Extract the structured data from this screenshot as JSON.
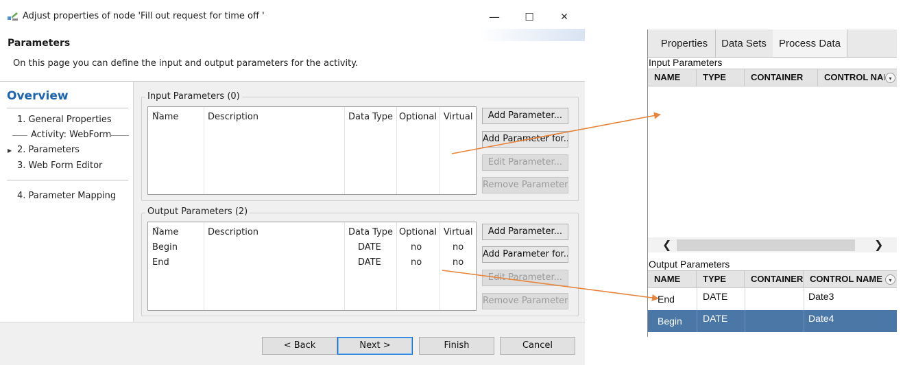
{
  "window": {
    "title": "Adjust properties of node 'Fill out request for time off '",
    "minimize_glyph": "—",
    "maximize_glyph": "☐",
    "close_glyph": "✕"
  },
  "header": {
    "title": "Parameters",
    "description": "On this page you can define the input and output parameters for the activity."
  },
  "nav": {
    "title": "Overview",
    "items": [
      {
        "label": "1. General Properties"
      },
      {
        "label": "2. Parameters"
      },
      {
        "label": "3. Web Form Editor"
      },
      {
        "label": "4. Parameter Mapping"
      }
    ],
    "group_label": "Activity: WebForm",
    "current_marker": "▶"
  },
  "input_params": {
    "label": "Input Parameters (0)",
    "columns": [
      "Name",
      "Description",
      "Data Type",
      "Optional",
      "Virtual"
    ],
    "buttons": {
      "add": "Add Parameter...",
      "add_for": "Add Parameter for...",
      "edit": "Edit Parameter...",
      "remove": "Remove Parameter"
    }
  },
  "output_params": {
    "label": "Output Parameters (2)",
    "columns": [
      "Name",
      "Description",
      "Data Type",
      "Optional",
      "Virtual"
    ],
    "rows": [
      {
        "name": "Begin",
        "description": "",
        "type": "DATE",
        "optional": "no",
        "virtual": "no"
      },
      {
        "name": "End",
        "description": "",
        "type": "DATE",
        "optional": "no",
        "virtual": "no"
      }
    ],
    "buttons": {
      "add": "Add Parameter...",
      "add_for": "Add Parameter for...",
      "edit": "Edit Parameter...",
      "remove": "Remove Parameter"
    }
  },
  "footer": {
    "back": "< Back",
    "next": "Next >",
    "finish": "Finish",
    "cancel": "Cancel"
  },
  "right_panel": {
    "tabs": [
      "Properties",
      "Data Sets",
      "Process Data"
    ],
    "active_tab": "Process Data",
    "input_label": "Input Parameters",
    "input_columns": [
      "NAME",
      "TYPE",
      "CONTAINER",
      "CONTROL NAME"
    ],
    "scroll_left": "❮",
    "scroll_right": "❯",
    "output_label": "Output Parameters",
    "output_columns": [
      "NAME",
      "TYPE",
      "CONTAINER",
      "CONTROL NAME"
    ],
    "output_rows": [
      {
        "name": "End",
        "type": "DATE",
        "container": "",
        "control": "Date3",
        "selected": false
      },
      {
        "name": "Begin",
        "type": "DATE",
        "container": "",
        "control": "Date4",
        "selected": true
      }
    ],
    "column_menu_glyph": "▾"
  },
  "colors": {
    "nav_title": "#1c64b0",
    "arrow": "#e8833a",
    "selected_row": "#4a77a6",
    "default_button_border": "#0a6fd6"
  }
}
